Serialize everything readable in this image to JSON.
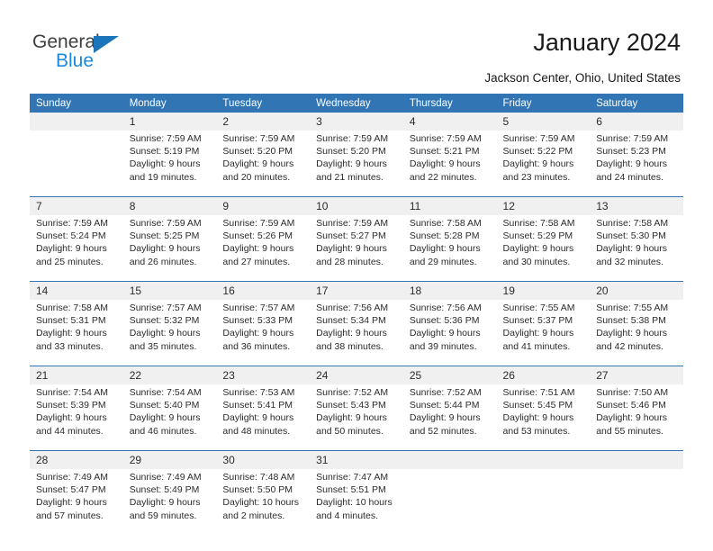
{
  "brand": {
    "name_part1": "General",
    "name_part2": "Blue",
    "color_dark": "#3f3f3f",
    "color_blue": "#1b8ade"
  },
  "header": {
    "title": "January 2024",
    "location": "Jackson Center, Ohio, United States",
    "header_bg": "#3175b4",
    "daynum_bg": "#f0f0f0"
  },
  "weekdays": [
    "Sunday",
    "Monday",
    "Tuesday",
    "Wednesday",
    "Thursday",
    "Friday",
    "Saturday"
  ],
  "weeks": [
    {
      "days": [
        {
          "num": "",
          "l1": "",
          "l2": "",
          "l3": "",
          "l4": ""
        },
        {
          "num": "1",
          "l1": "Sunrise: 7:59 AM",
          "l2": "Sunset: 5:19 PM",
          "l3": "Daylight: 9 hours",
          "l4": "and 19 minutes."
        },
        {
          "num": "2",
          "l1": "Sunrise: 7:59 AM",
          "l2": "Sunset: 5:20 PM",
          "l3": "Daylight: 9 hours",
          "l4": "and 20 minutes."
        },
        {
          "num": "3",
          "l1": "Sunrise: 7:59 AM",
          "l2": "Sunset: 5:20 PM",
          "l3": "Daylight: 9 hours",
          "l4": "and 21 minutes."
        },
        {
          "num": "4",
          "l1": "Sunrise: 7:59 AM",
          "l2": "Sunset: 5:21 PM",
          "l3": "Daylight: 9 hours",
          "l4": "and 22 minutes."
        },
        {
          "num": "5",
          "l1": "Sunrise: 7:59 AM",
          "l2": "Sunset: 5:22 PM",
          "l3": "Daylight: 9 hours",
          "l4": "and 23 minutes."
        },
        {
          "num": "6",
          "l1": "Sunrise: 7:59 AM",
          "l2": "Sunset: 5:23 PM",
          "l3": "Daylight: 9 hours",
          "l4": "and 24 minutes."
        }
      ]
    },
    {
      "days": [
        {
          "num": "7",
          "l1": "Sunrise: 7:59 AM",
          "l2": "Sunset: 5:24 PM",
          "l3": "Daylight: 9 hours",
          "l4": "and 25 minutes."
        },
        {
          "num": "8",
          "l1": "Sunrise: 7:59 AM",
          "l2": "Sunset: 5:25 PM",
          "l3": "Daylight: 9 hours",
          "l4": "and 26 minutes."
        },
        {
          "num": "9",
          "l1": "Sunrise: 7:59 AM",
          "l2": "Sunset: 5:26 PM",
          "l3": "Daylight: 9 hours",
          "l4": "and 27 minutes."
        },
        {
          "num": "10",
          "l1": "Sunrise: 7:59 AM",
          "l2": "Sunset: 5:27 PM",
          "l3": "Daylight: 9 hours",
          "l4": "and 28 minutes."
        },
        {
          "num": "11",
          "l1": "Sunrise: 7:58 AM",
          "l2": "Sunset: 5:28 PM",
          "l3": "Daylight: 9 hours",
          "l4": "and 29 minutes."
        },
        {
          "num": "12",
          "l1": "Sunrise: 7:58 AM",
          "l2": "Sunset: 5:29 PM",
          "l3": "Daylight: 9 hours",
          "l4": "and 30 minutes."
        },
        {
          "num": "13",
          "l1": "Sunrise: 7:58 AM",
          "l2": "Sunset: 5:30 PM",
          "l3": "Daylight: 9 hours",
          "l4": "and 32 minutes."
        }
      ]
    },
    {
      "days": [
        {
          "num": "14",
          "l1": "Sunrise: 7:58 AM",
          "l2": "Sunset: 5:31 PM",
          "l3": "Daylight: 9 hours",
          "l4": "and 33 minutes."
        },
        {
          "num": "15",
          "l1": "Sunrise: 7:57 AM",
          "l2": "Sunset: 5:32 PM",
          "l3": "Daylight: 9 hours",
          "l4": "and 35 minutes."
        },
        {
          "num": "16",
          "l1": "Sunrise: 7:57 AM",
          "l2": "Sunset: 5:33 PM",
          "l3": "Daylight: 9 hours",
          "l4": "and 36 minutes."
        },
        {
          "num": "17",
          "l1": "Sunrise: 7:56 AM",
          "l2": "Sunset: 5:34 PM",
          "l3": "Daylight: 9 hours",
          "l4": "and 38 minutes."
        },
        {
          "num": "18",
          "l1": "Sunrise: 7:56 AM",
          "l2": "Sunset: 5:36 PM",
          "l3": "Daylight: 9 hours",
          "l4": "and 39 minutes."
        },
        {
          "num": "19",
          "l1": "Sunrise: 7:55 AM",
          "l2": "Sunset: 5:37 PM",
          "l3": "Daylight: 9 hours",
          "l4": "and 41 minutes."
        },
        {
          "num": "20",
          "l1": "Sunrise: 7:55 AM",
          "l2": "Sunset: 5:38 PM",
          "l3": "Daylight: 9 hours",
          "l4": "and 42 minutes."
        }
      ]
    },
    {
      "days": [
        {
          "num": "21",
          "l1": "Sunrise: 7:54 AM",
          "l2": "Sunset: 5:39 PM",
          "l3": "Daylight: 9 hours",
          "l4": "and 44 minutes."
        },
        {
          "num": "22",
          "l1": "Sunrise: 7:54 AM",
          "l2": "Sunset: 5:40 PM",
          "l3": "Daylight: 9 hours",
          "l4": "and 46 minutes."
        },
        {
          "num": "23",
          "l1": "Sunrise: 7:53 AM",
          "l2": "Sunset: 5:41 PM",
          "l3": "Daylight: 9 hours",
          "l4": "and 48 minutes."
        },
        {
          "num": "24",
          "l1": "Sunrise: 7:52 AM",
          "l2": "Sunset: 5:43 PM",
          "l3": "Daylight: 9 hours",
          "l4": "and 50 minutes."
        },
        {
          "num": "25",
          "l1": "Sunrise: 7:52 AM",
          "l2": "Sunset: 5:44 PM",
          "l3": "Daylight: 9 hours",
          "l4": "and 52 minutes."
        },
        {
          "num": "26",
          "l1": "Sunrise: 7:51 AM",
          "l2": "Sunset: 5:45 PM",
          "l3": "Daylight: 9 hours",
          "l4": "and 53 minutes."
        },
        {
          "num": "27",
          "l1": "Sunrise: 7:50 AM",
          "l2": "Sunset: 5:46 PM",
          "l3": "Daylight: 9 hours",
          "l4": "and 55 minutes."
        }
      ]
    },
    {
      "days": [
        {
          "num": "28",
          "l1": "Sunrise: 7:49 AM",
          "l2": "Sunset: 5:47 PM",
          "l3": "Daylight: 9 hours",
          "l4": "and 57 minutes."
        },
        {
          "num": "29",
          "l1": "Sunrise: 7:49 AM",
          "l2": "Sunset: 5:49 PM",
          "l3": "Daylight: 9 hours",
          "l4": "and 59 minutes."
        },
        {
          "num": "30",
          "l1": "Sunrise: 7:48 AM",
          "l2": "Sunset: 5:50 PM",
          "l3": "Daylight: 10 hours",
          "l4": "and 2 minutes."
        },
        {
          "num": "31",
          "l1": "Sunrise: 7:47 AM",
          "l2": "Sunset: 5:51 PM",
          "l3": "Daylight: 10 hours",
          "l4": "and 4 minutes."
        },
        {
          "num": "",
          "l1": "",
          "l2": "",
          "l3": "",
          "l4": ""
        },
        {
          "num": "",
          "l1": "",
          "l2": "",
          "l3": "",
          "l4": ""
        },
        {
          "num": "",
          "l1": "",
          "l2": "",
          "l3": "",
          "l4": ""
        }
      ]
    }
  ]
}
